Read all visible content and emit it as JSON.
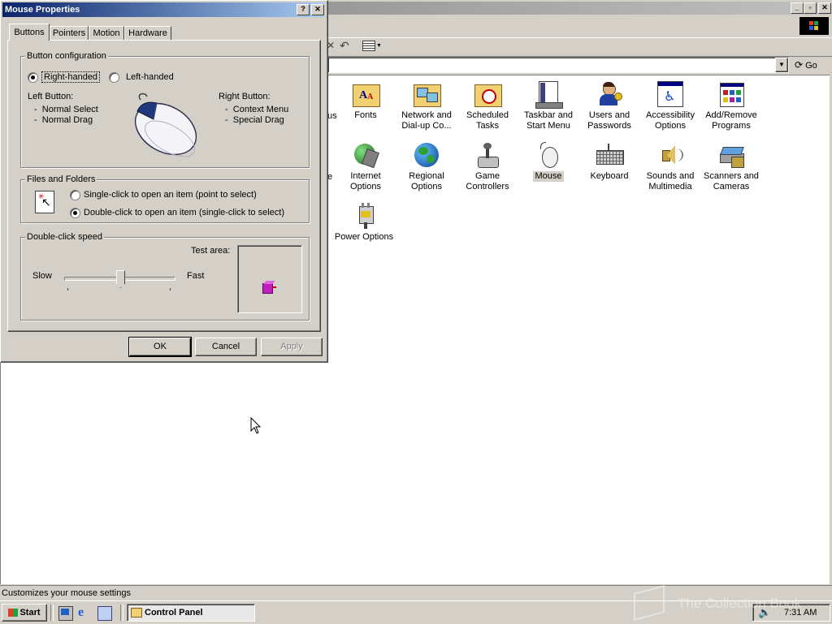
{
  "cp_window": {
    "address_go": "Go",
    "icons": [
      {
        "name": "icon-fonts",
        "label": "Fonts",
        "icon": "fonts-folder-icon"
      },
      {
        "name": "icon-network",
        "label": "Network and Dial-up Co...",
        "icon": "network-icon"
      },
      {
        "name": "icon-scheduled-tasks",
        "label": "Scheduled Tasks",
        "icon": "scheduled-tasks-icon"
      },
      {
        "name": "icon-taskbar",
        "label": "Taskbar and Start Menu",
        "icon": "taskbar-icon"
      },
      {
        "name": "icon-users",
        "label": "Users and Passwords",
        "icon": "users-icon"
      },
      {
        "name": "icon-accessibility",
        "label": "Accessibility Options",
        "icon": "accessibility-icon"
      },
      {
        "name": "icon-add-remove",
        "label": "Add/Remove Programs",
        "icon": "add-remove-icon"
      },
      {
        "name": "icon-internet",
        "label": "Internet Options",
        "icon": "internet-icon"
      },
      {
        "name": "icon-regional",
        "label": "Regional Options",
        "icon": "globe-icon"
      },
      {
        "name": "icon-game",
        "label": "Game Controllers",
        "icon": "joystick-icon"
      },
      {
        "name": "icon-mouse",
        "label": "Mouse",
        "icon": "mouse-icon"
      },
      {
        "name": "icon-keyboard",
        "label": "Keyboard",
        "icon": "keyboard-icon"
      },
      {
        "name": "icon-sounds",
        "label": "Sounds and Multimedia",
        "icon": "speaker-icon"
      },
      {
        "name": "icon-scanners",
        "label": "Scanners and Cameras",
        "icon": "scanner-icon"
      },
      {
        "name": "icon-power",
        "label": "Power Options",
        "icon": "power-icon"
      }
    ],
    "partial_labels": [
      "us",
      "e"
    ],
    "status_text": "Customizes your mouse settings"
  },
  "dialog": {
    "title": "Mouse Properties",
    "help_btn": "?",
    "close_btn": "X",
    "tabs": [
      "Buttons",
      "Pointers",
      "Motion",
      "Hardware"
    ],
    "active_tab": "Buttons",
    "button_config": {
      "group_label": "Button configuration",
      "right_handed": "Right-handed",
      "left_handed": "Left-handed",
      "selected": "Right-handed",
      "left_button_title": "Left Button:",
      "left_button_items": [
        "Normal Select",
        "Normal Drag"
      ],
      "right_button_title": "Right Button:",
      "right_button_items": [
        "Context Menu",
        "Special Drag"
      ]
    },
    "files_folders": {
      "group_label": "Files and Folders",
      "single_click": "Single-click to open an item (point to select)",
      "double_click": "Double-click to open an item (single-click to select)",
      "selected": "double"
    },
    "double_click_speed": {
      "group_label": "Double-click speed",
      "slow": "Slow",
      "fast": "Fast",
      "test_area": "Test area:",
      "slider_value": 0.5
    },
    "ok": "OK",
    "cancel": "Cancel",
    "apply": "Apply"
  },
  "taskbar": {
    "start": "Start",
    "task": "Control Panel",
    "clock": "7:31 AM"
  },
  "watermark": "The Collection Book",
  "colors": {
    "title_active": "#0a246a",
    "face": "#d4d0c8",
    "selection": "#c0c0c0"
  }
}
